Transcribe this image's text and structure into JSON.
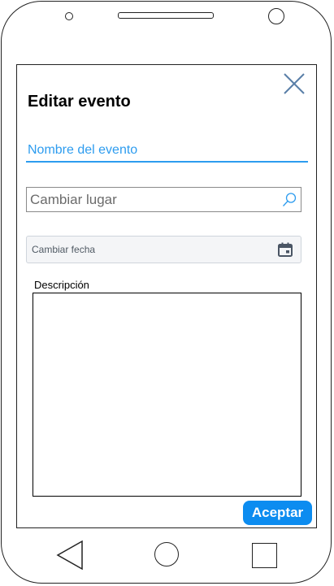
{
  "dialog": {
    "title": "Editar evento",
    "close_icon": "close-icon",
    "event_name": {
      "placeholder": "Nombre del evento",
      "value": ""
    },
    "location": {
      "placeholder": "Cambiar lugar",
      "value": "",
      "icon": "search-icon"
    },
    "date": {
      "placeholder": "Cambiar fecha",
      "value": "",
      "icon": "calendar-icon"
    },
    "description": {
      "label": "Descripción",
      "value": ""
    },
    "accept_label": "Aceptar"
  },
  "nav_bar": {
    "back_icon": "back-triangle-icon",
    "home_icon": "home-circle-icon",
    "recent_icon": "recent-apps-square-icon"
  },
  "colors": {
    "accent": "#2d9cef",
    "button": "#0c8cf0",
    "frame": "#222222"
  }
}
